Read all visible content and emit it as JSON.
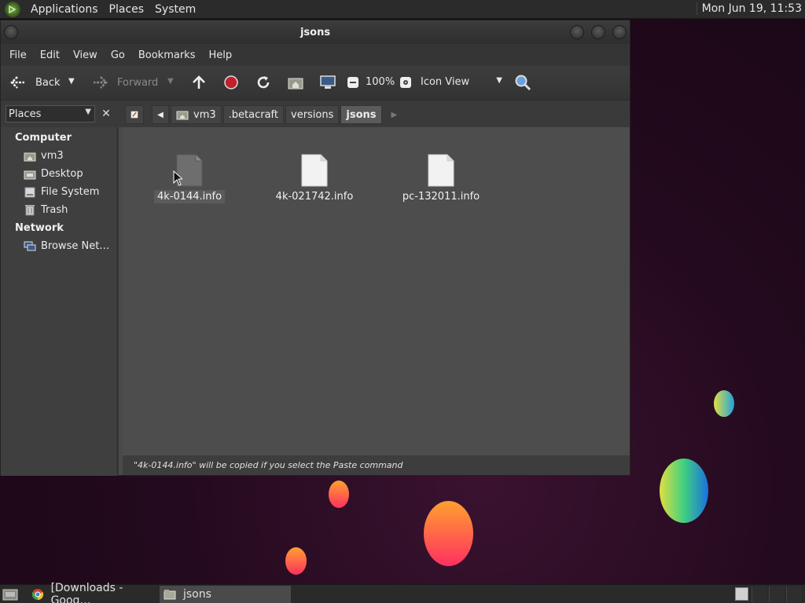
{
  "top_panel": {
    "menus": [
      "Applications",
      "Places",
      "System"
    ],
    "clock": "Mon Jun 19, 11:53"
  },
  "window": {
    "title": "jsons",
    "menubar": [
      "File",
      "Edit",
      "View",
      "Go",
      "Bookmarks",
      "Help"
    ],
    "toolbar": {
      "back_label": "Back",
      "forward_label": "Forward",
      "zoom_level": "100%",
      "view_mode": "Icon View"
    },
    "location": {
      "side_pane_selector": "Places",
      "breadcrumbs": [
        "vm3",
        ".betacraft",
        "versions",
        "jsons"
      ]
    },
    "sidebar": {
      "sections": [
        {
          "heading": "Computer",
          "items": [
            "vm3",
            "Desktop",
            "File System",
            "Trash"
          ]
        },
        {
          "heading": "Network",
          "items": [
            "Browse Net…"
          ]
        }
      ]
    },
    "files": [
      {
        "name": "4k-0144.info",
        "selected": true
      },
      {
        "name": "4k-021742.info",
        "selected": false
      },
      {
        "name": "pc-132011.info",
        "selected": false
      }
    ],
    "status": "\"4k-0144.info\" will be copied if you select the Paste command"
  },
  "bottom_panel": {
    "tasks": [
      "[Downloads - Goog…",
      "jsons"
    ]
  },
  "colors": {
    "panel": "#2b2b2b",
    "window_bg": "#4d4d4d",
    "sidebar_bg": "#3f3f3f",
    "stop_red": "#c0202a"
  }
}
